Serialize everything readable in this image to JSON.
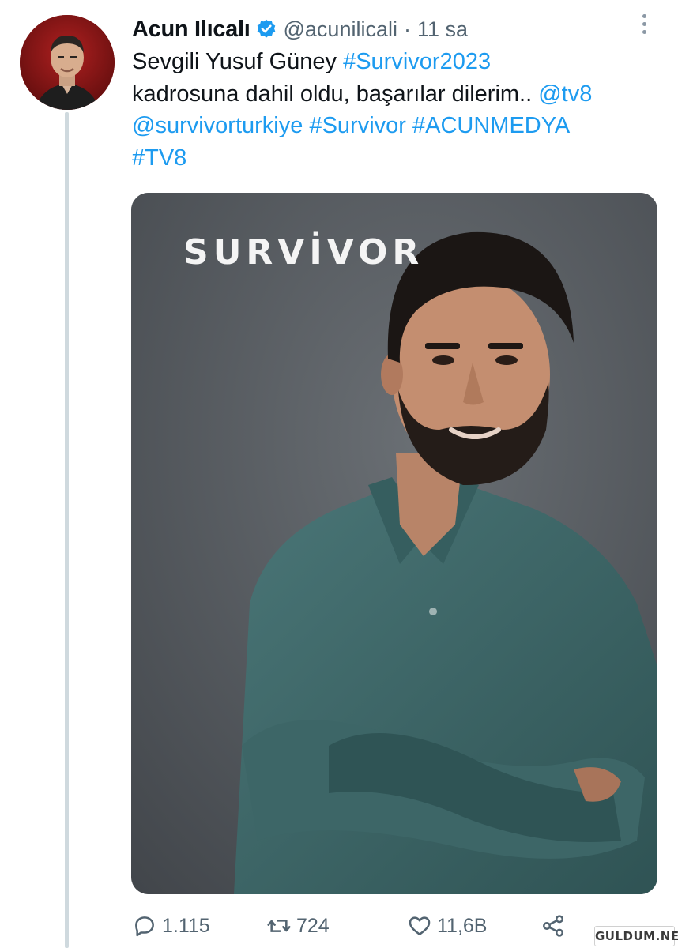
{
  "author": {
    "display_name": "Acun Ilıcalı",
    "handle": "@acunilicali",
    "separator": "·",
    "time": "11 sa",
    "verified": true
  },
  "tweet": {
    "line1_text": "Sevgili Yusuf Güney ",
    "line1_hashtag": "#Survivor2023",
    "line2_text": "kadrosuna dahil oldu, başarılar dilerim.. ",
    "line2_mention": "@tv8",
    "line3_mention": "@survivorturkiye",
    "line3_hashtag1": "#Survivor",
    "line3_hashtag2": "#ACUNMEDYA",
    "line4_hashtag": "#TV8"
  },
  "media": {
    "logo_text": "SURVİVOR"
  },
  "actions": {
    "reply_count": "1.115",
    "retweet_count": "724",
    "like_count": "11,6B"
  },
  "watermark": "GULDUM.NET",
  "colors": {
    "link": "#1d9bf0",
    "secondary_text": "#536471",
    "thread_line": "#cfd9de",
    "media_bg": "#55595e",
    "shirt": "#3f6768"
  }
}
